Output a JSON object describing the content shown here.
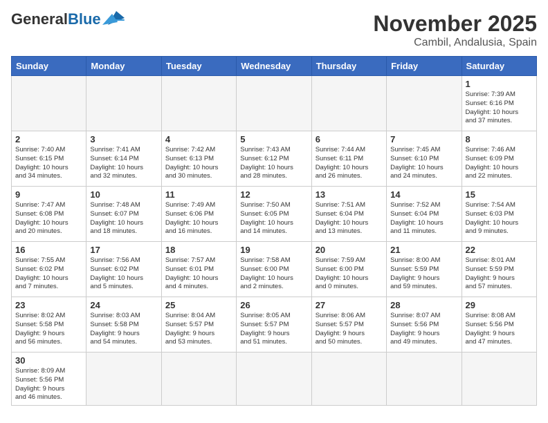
{
  "header": {
    "logo_general": "General",
    "logo_blue": "Blue",
    "month_title": "November 2025",
    "location": "Cambil, Andalusia, Spain"
  },
  "weekdays": [
    "Sunday",
    "Monday",
    "Tuesday",
    "Wednesday",
    "Thursday",
    "Friday",
    "Saturday"
  ],
  "days": [
    {
      "date": "",
      "info": ""
    },
    {
      "date": "",
      "info": ""
    },
    {
      "date": "",
      "info": ""
    },
    {
      "date": "",
      "info": ""
    },
    {
      "date": "",
      "info": ""
    },
    {
      "date": "",
      "info": ""
    },
    {
      "date": "1",
      "info": "Sunrise: 7:39 AM\nSunset: 6:16 PM\nDaylight: 10 hours\nand 37 minutes."
    },
    {
      "date": "2",
      "info": "Sunrise: 7:40 AM\nSunset: 6:15 PM\nDaylight: 10 hours\nand 34 minutes."
    },
    {
      "date": "3",
      "info": "Sunrise: 7:41 AM\nSunset: 6:14 PM\nDaylight: 10 hours\nand 32 minutes."
    },
    {
      "date": "4",
      "info": "Sunrise: 7:42 AM\nSunset: 6:13 PM\nDaylight: 10 hours\nand 30 minutes."
    },
    {
      "date": "5",
      "info": "Sunrise: 7:43 AM\nSunset: 6:12 PM\nDaylight: 10 hours\nand 28 minutes."
    },
    {
      "date": "6",
      "info": "Sunrise: 7:44 AM\nSunset: 6:11 PM\nDaylight: 10 hours\nand 26 minutes."
    },
    {
      "date": "7",
      "info": "Sunrise: 7:45 AM\nSunset: 6:10 PM\nDaylight: 10 hours\nand 24 minutes."
    },
    {
      "date": "8",
      "info": "Sunrise: 7:46 AM\nSunset: 6:09 PM\nDaylight: 10 hours\nand 22 minutes."
    },
    {
      "date": "9",
      "info": "Sunrise: 7:47 AM\nSunset: 6:08 PM\nDaylight: 10 hours\nand 20 minutes."
    },
    {
      "date": "10",
      "info": "Sunrise: 7:48 AM\nSunset: 6:07 PM\nDaylight: 10 hours\nand 18 minutes."
    },
    {
      "date": "11",
      "info": "Sunrise: 7:49 AM\nSunset: 6:06 PM\nDaylight: 10 hours\nand 16 minutes."
    },
    {
      "date": "12",
      "info": "Sunrise: 7:50 AM\nSunset: 6:05 PM\nDaylight: 10 hours\nand 14 minutes."
    },
    {
      "date": "13",
      "info": "Sunrise: 7:51 AM\nSunset: 6:04 PM\nDaylight: 10 hours\nand 13 minutes."
    },
    {
      "date": "14",
      "info": "Sunrise: 7:52 AM\nSunset: 6:04 PM\nDaylight: 10 hours\nand 11 minutes."
    },
    {
      "date": "15",
      "info": "Sunrise: 7:54 AM\nSunset: 6:03 PM\nDaylight: 10 hours\nand 9 minutes."
    },
    {
      "date": "16",
      "info": "Sunrise: 7:55 AM\nSunset: 6:02 PM\nDaylight: 10 hours\nand 7 minutes."
    },
    {
      "date": "17",
      "info": "Sunrise: 7:56 AM\nSunset: 6:02 PM\nDaylight: 10 hours\nand 5 minutes."
    },
    {
      "date": "18",
      "info": "Sunrise: 7:57 AM\nSunset: 6:01 PM\nDaylight: 10 hours\nand 4 minutes."
    },
    {
      "date": "19",
      "info": "Sunrise: 7:58 AM\nSunset: 6:00 PM\nDaylight: 10 hours\nand 2 minutes."
    },
    {
      "date": "20",
      "info": "Sunrise: 7:59 AM\nSunset: 6:00 PM\nDaylight: 10 hours\nand 0 minutes."
    },
    {
      "date": "21",
      "info": "Sunrise: 8:00 AM\nSunset: 5:59 PM\nDaylight: 9 hours\nand 59 minutes."
    },
    {
      "date": "22",
      "info": "Sunrise: 8:01 AM\nSunset: 5:59 PM\nDaylight: 9 hours\nand 57 minutes."
    },
    {
      "date": "23",
      "info": "Sunrise: 8:02 AM\nSunset: 5:58 PM\nDaylight: 9 hours\nand 56 minutes."
    },
    {
      "date": "24",
      "info": "Sunrise: 8:03 AM\nSunset: 5:58 PM\nDaylight: 9 hours\nand 54 minutes."
    },
    {
      "date": "25",
      "info": "Sunrise: 8:04 AM\nSunset: 5:57 PM\nDaylight: 9 hours\nand 53 minutes."
    },
    {
      "date": "26",
      "info": "Sunrise: 8:05 AM\nSunset: 5:57 PM\nDaylight: 9 hours\nand 51 minutes."
    },
    {
      "date": "27",
      "info": "Sunrise: 8:06 AM\nSunset: 5:57 PM\nDaylight: 9 hours\nand 50 minutes."
    },
    {
      "date": "28",
      "info": "Sunrise: 8:07 AM\nSunset: 5:56 PM\nDaylight: 9 hours\nand 49 minutes."
    },
    {
      "date": "29",
      "info": "Sunrise: 8:08 AM\nSunset: 5:56 PM\nDaylight: 9 hours\nand 47 minutes."
    },
    {
      "date": "30",
      "info": "Sunrise: 8:09 AM\nSunset: 5:56 PM\nDaylight: 9 hours\nand 46 minutes."
    },
    {
      "date": "",
      "info": ""
    },
    {
      "date": "",
      "info": ""
    },
    {
      "date": "",
      "info": ""
    },
    {
      "date": "",
      "info": ""
    },
    {
      "date": "",
      "info": ""
    },
    {
      "date": "",
      "info": ""
    }
  ]
}
